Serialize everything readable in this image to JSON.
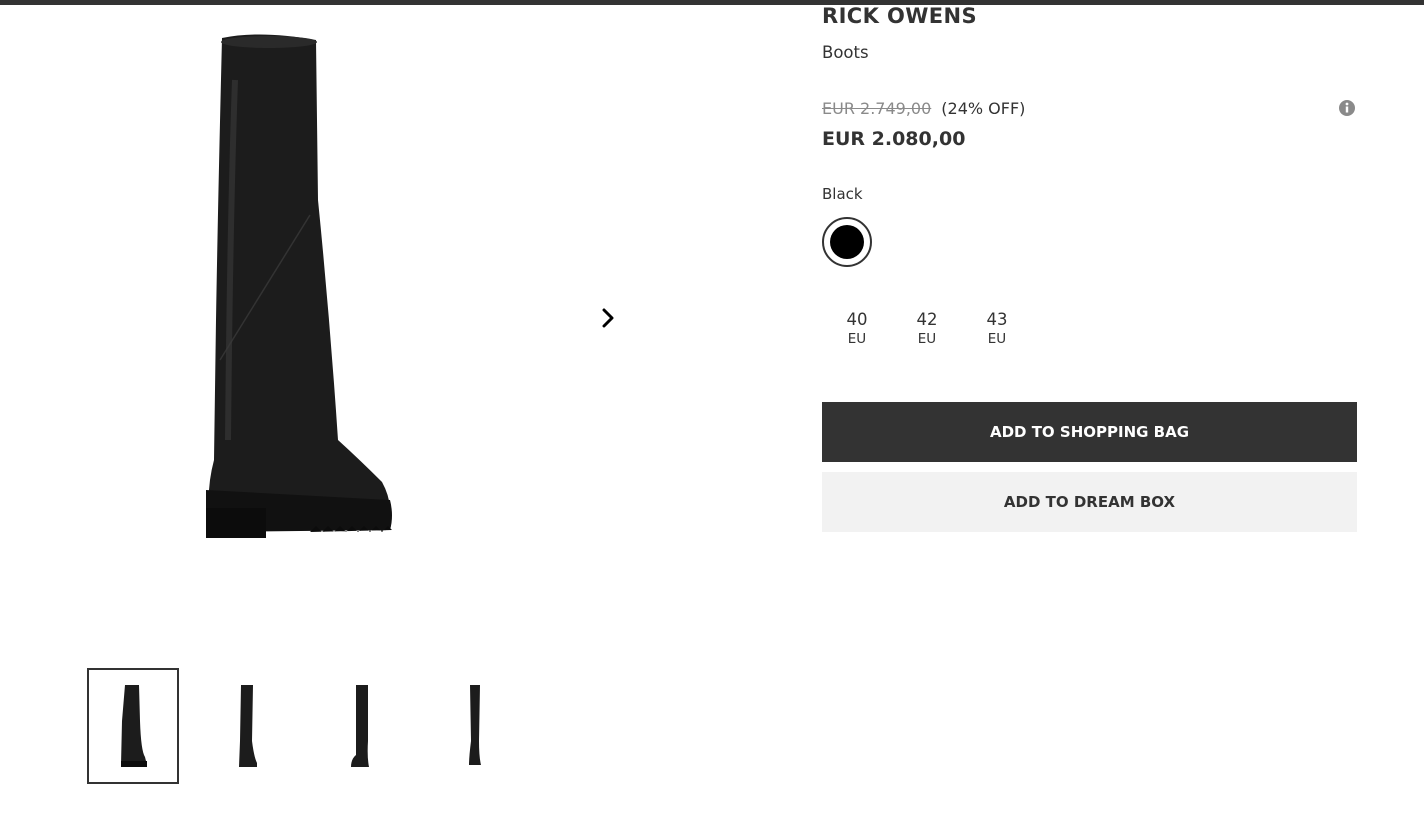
{
  "product": {
    "brand": "RICK OWENS",
    "category": "Boots",
    "old_price": "EUR 2.749,00",
    "discount": "(24% OFF)",
    "new_price": "EUR 2.080,00",
    "color_name": "Black",
    "swatch_color": "#000000"
  },
  "sizes": [
    {
      "number": "40",
      "unit": "EU"
    },
    {
      "number": "42",
      "unit": "EU"
    },
    {
      "number": "43",
      "unit": "EU"
    }
  ],
  "actions": {
    "add_to_bag": "ADD TO SHOPPING BAG",
    "add_to_dream_box": "ADD TO DREAM BOX"
  },
  "icons": {
    "next": "chevron-right-icon",
    "info": "info-icon"
  },
  "colors": {
    "dark": "#333333",
    "light_button": "#f2f2f2",
    "muted_text": "#8a8a8a"
  }
}
